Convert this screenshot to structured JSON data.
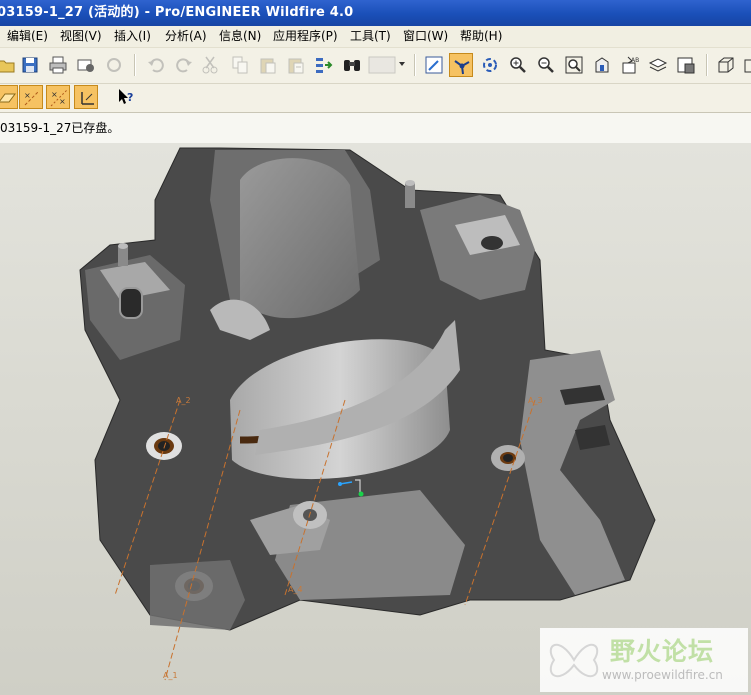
{
  "window": {
    "title": "03159-1_27 (活动的) - Pro/ENGINEER Wildfire 4.0"
  },
  "menu": [
    "编辑(E)",
    "视图(V)",
    "插入(I)",
    "分析(A)",
    "信息(N)",
    "应用程序(P)",
    "工具(T)",
    "窗口(W)",
    "帮助(H)"
  ],
  "message": "03159-1_27已存盘。",
  "axes": [
    "A_1",
    "A_2",
    "A_3",
    "A_4"
  ],
  "watermark": {
    "title": "野火论坛",
    "url": "www.proewildfire.cn"
  },
  "toolbar1": [
    "open-icon",
    "save-icon",
    "print-icon",
    "send-icon",
    "regenerate-icon",
    "undo-icon",
    "redo-icon",
    "cut-icon",
    "copy-icon",
    "paste-icon",
    "paste-special-icon",
    "regen-manager-icon",
    "find-icon",
    "selection-filter-dropdown",
    "repaint-icon",
    "spin-center-icon",
    "orient-mode-icon",
    "zoom-in-icon",
    "zoom-out-icon",
    "refit-icon",
    "reorient-icon",
    "saved-views-icon",
    "layers-icon",
    "view-manager-icon",
    "display-style-icon"
  ],
  "toolbar2": [
    "datum-planes-icon",
    "datum-axes-icon",
    "datum-points-icon",
    "csys-icon",
    "whats-this-icon"
  ],
  "colors": {
    "titlebar": "#1a4fb8",
    "active_button": "#f6c262",
    "model": "#5a5a5a"
  }
}
